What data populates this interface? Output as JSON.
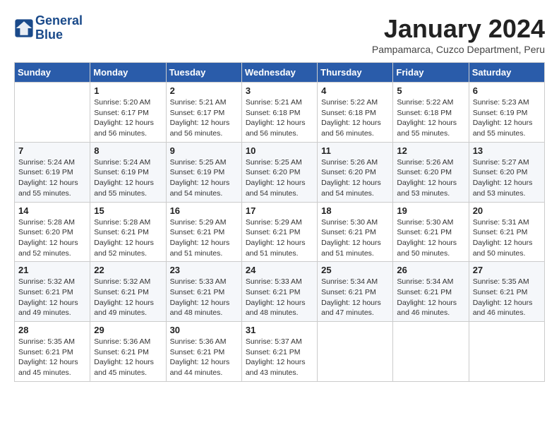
{
  "header": {
    "logo_line1": "General",
    "logo_line2": "Blue",
    "month_title": "January 2024",
    "location": "Pampamarca, Cuzco Department, Peru"
  },
  "weekdays": [
    "Sunday",
    "Monday",
    "Tuesday",
    "Wednesday",
    "Thursday",
    "Friday",
    "Saturday"
  ],
  "weeks": [
    [
      {
        "day": "",
        "info": ""
      },
      {
        "day": "1",
        "info": "Sunrise: 5:20 AM\nSunset: 6:17 PM\nDaylight: 12 hours\nand 56 minutes."
      },
      {
        "day": "2",
        "info": "Sunrise: 5:21 AM\nSunset: 6:17 PM\nDaylight: 12 hours\nand 56 minutes."
      },
      {
        "day": "3",
        "info": "Sunrise: 5:21 AM\nSunset: 6:18 PM\nDaylight: 12 hours\nand 56 minutes."
      },
      {
        "day": "4",
        "info": "Sunrise: 5:22 AM\nSunset: 6:18 PM\nDaylight: 12 hours\nand 56 minutes."
      },
      {
        "day": "5",
        "info": "Sunrise: 5:22 AM\nSunset: 6:18 PM\nDaylight: 12 hours\nand 55 minutes."
      },
      {
        "day": "6",
        "info": "Sunrise: 5:23 AM\nSunset: 6:19 PM\nDaylight: 12 hours\nand 55 minutes."
      }
    ],
    [
      {
        "day": "7",
        "info": "Sunrise: 5:24 AM\nSunset: 6:19 PM\nDaylight: 12 hours\nand 55 minutes."
      },
      {
        "day": "8",
        "info": "Sunrise: 5:24 AM\nSunset: 6:19 PM\nDaylight: 12 hours\nand 55 minutes."
      },
      {
        "day": "9",
        "info": "Sunrise: 5:25 AM\nSunset: 6:19 PM\nDaylight: 12 hours\nand 54 minutes."
      },
      {
        "day": "10",
        "info": "Sunrise: 5:25 AM\nSunset: 6:20 PM\nDaylight: 12 hours\nand 54 minutes."
      },
      {
        "day": "11",
        "info": "Sunrise: 5:26 AM\nSunset: 6:20 PM\nDaylight: 12 hours\nand 54 minutes."
      },
      {
        "day": "12",
        "info": "Sunrise: 5:26 AM\nSunset: 6:20 PM\nDaylight: 12 hours\nand 53 minutes."
      },
      {
        "day": "13",
        "info": "Sunrise: 5:27 AM\nSunset: 6:20 PM\nDaylight: 12 hours\nand 53 minutes."
      }
    ],
    [
      {
        "day": "14",
        "info": "Sunrise: 5:28 AM\nSunset: 6:20 PM\nDaylight: 12 hours\nand 52 minutes."
      },
      {
        "day": "15",
        "info": "Sunrise: 5:28 AM\nSunset: 6:21 PM\nDaylight: 12 hours\nand 52 minutes."
      },
      {
        "day": "16",
        "info": "Sunrise: 5:29 AM\nSunset: 6:21 PM\nDaylight: 12 hours\nand 51 minutes."
      },
      {
        "day": "17",
        "info": "Sunrise: 5:29 AM\nSunset: 6:21 PM\nDaylight: 12 hours\nand 51 minutes."
      },
      {
        "day": "18",
        "info": "Sunrise: 5:30 AM\nSunset: 6:21 PM\nDaylight: 12 hours\nand 51 minutes."
      },
      {
        "day": "19",
        "info": "Sunrise: 5:30 AM\nSunset: 6:21 PM\nDaylight: 12 hours\nand 50 minutes."
      },
      {
        "day": "20",
        "info": "Sunrise: 5:31 AM\nSunset: 6:21 PM\nDaylight: 12 hours\nand 50 minutes."
      }
    ],
    [
      {
        "day": "21",
        "info": "Sunrise: 5:32 AM\nSunset: 6:21 PM\nDaylight: 12 hours\nand 49 minutes."
      },
      {
        "day": "22",
        "info": "Sunrise: 5:32 AM\nSunset: 6:21 PM\nDaylight: 12 hours\nand 49 minutes."
      },
      {
        "day": "23",
        "info": "Sunrise: 5:33 AM\nSunset: 6:21 PM\nDaylight: 12 hours\nand 48 minutes."
      },
      {
        "day": "24",
        "info": "Sunrise: 5:33 AM\nSunset: 6:21 PM\nDaylight: 12 hours\nand 48 minutes."
      },
      {
        "day": "25",
        "info": "Sunrise: 5:34 AM\nSunset: 6:21 PM\nDaylight: 12 hours\nand 47 minutes."
      },
      {
        "day": "26",
        "info": "Sunrise: 5:34 AM\nSunset: 6:21 PM\nDaylight: 12 hours\nand 46 minutes."
      },
      {
        "day": "27",
        "info": "Sunrise: 5:35 AM\nSunset: 6:21 PM\nDaylight: 12 hours\nand 46 minutes."
      }
    ],
    [
      {
        "day": "28",
        "info": "Sunrise: 5:35 AM\nSunset: 6:21 PM\nDaylight: 12 hours\nand 45 minutes."
      },
      {
        "day": "29",
        "info": "Sunrise: 5:36 AM\nSunset: 6:21 PM\nDaylight: 12 hours\nand 45 minutes."
      },
      {
        "day": "30",
        "info": "Sunrise: 5:36 AM\nSunset: 6:21 PM\nDaylight: 12 hours\nand 44 minutes."
      },
      {
        "day": "31",
        "info": "Sunrise: 5:37 AM\nSunset: 6:21 PM\nDaylight: 12 hours\nand 43 minutes."
      },
      {
        "day": "",
        "info": ""
      },
      {
        "day": "",
        "info": ""
      },
      {
        "day": "",
        "info": ""
      }
    ]
  ]
}
